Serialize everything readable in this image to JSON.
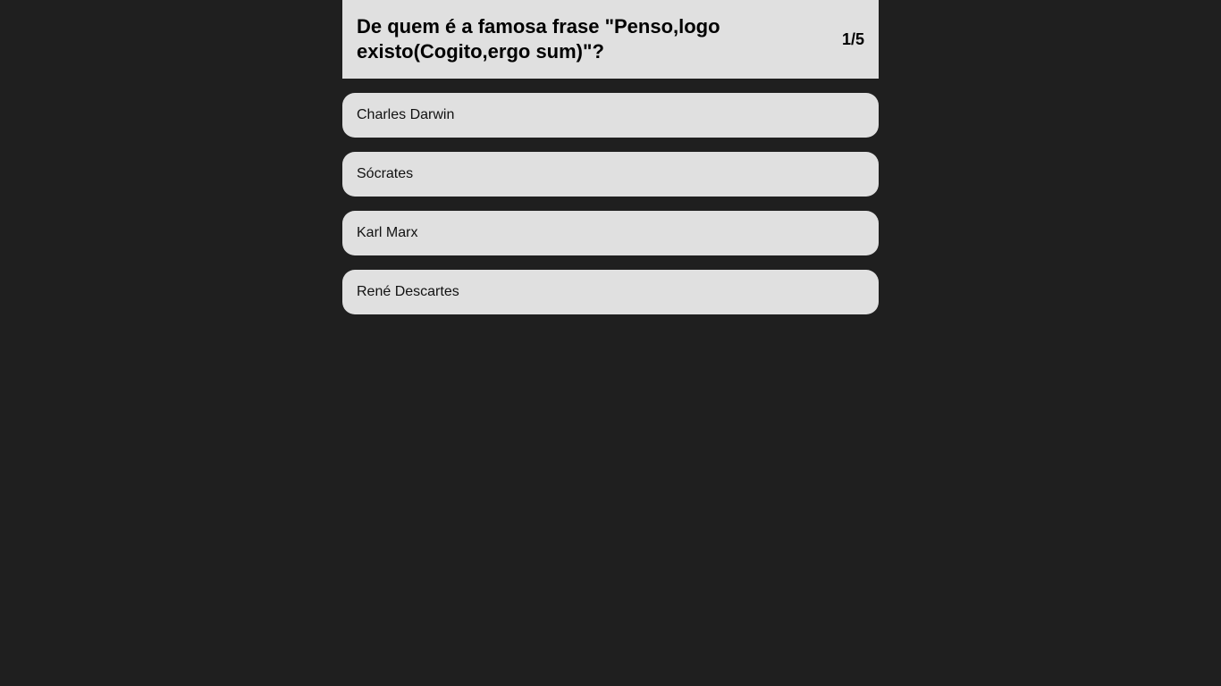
{
  "question": {
    "text": "De quem é a famosa frase \"Penso,logo existo(Cogito,ergo sum)\"?",
    "progress": "1/5"
  },
  "options": [
    {
      "label": "Charles Darwin"
    },
    {
      "label": "Sócrates"
    },
    {
      "label": "Karl Marx"
    },
    {
      "label": "René Descartes"
    }
  ]
}
